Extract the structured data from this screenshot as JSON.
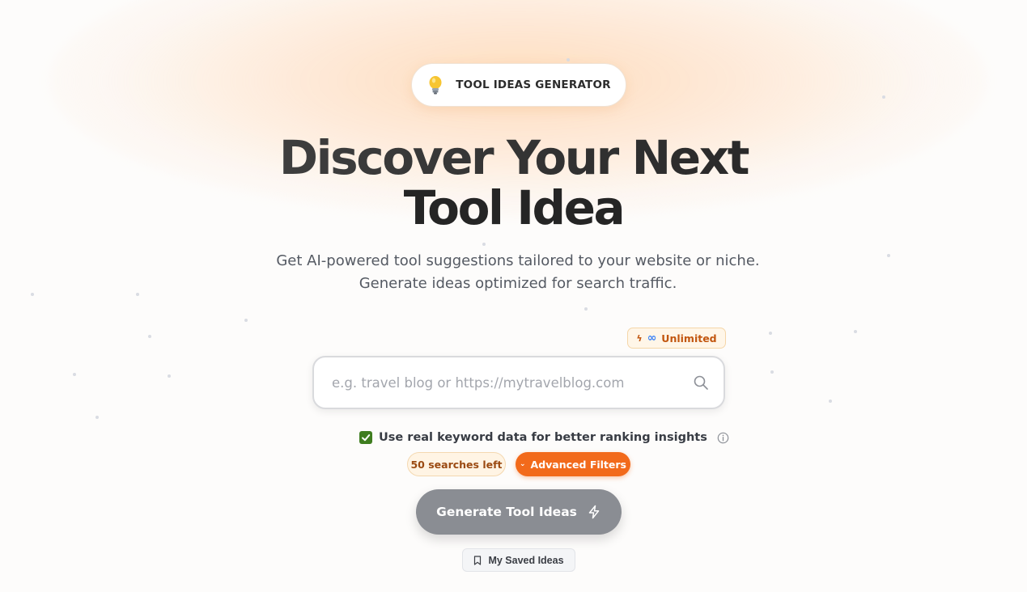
{
  "hero": {
    "badge_label": "TOOL IDEAS GENERATOR",
    "headline_line1": "Discover Your Next",
    "headline_line2": "Tool Idea",
    "subtitle": "Get AI-powered tool suggestions tailored to your website or niche. Generate ideas optimized for search traffic."
  },
  "plan_badge": {
    "label": "Unlimited"
  },
  "search": {
    "value": "",
    "placeholder": "e.g. travel blog or https://mytravelblog.com"
  },
  "options": {
    "keyword_checkbox_label": "Use real keyword data for better ranking insights",
    "keyword_checkbox_checked": true,
    "searches_left": "50 searches left",
    "advanced_filters_label": "Advanced Filters"
  },
  "actions": {
    "generate_label": "Generate Tool Ideas",
    "saved_label": "My Saved Ideas"
  },
  "colors": {
    "accent_orange": "#f26a1b",
    "checkbox_green": "#3f7d1f",
    "generate_button_gray": "#8a8d93"
  },
  "icons": {
    "badge": "lightbulb-icon",
    "plan": [
      "bolt-icon",
      "infinity-icon"
    ],
    "search": "search-icon",
    "info": "info-icon",
    "filters": "chevron-down-icon",
    "generate": "bolt-icon",
    "saved": "bookmark-icon"
  }
}
